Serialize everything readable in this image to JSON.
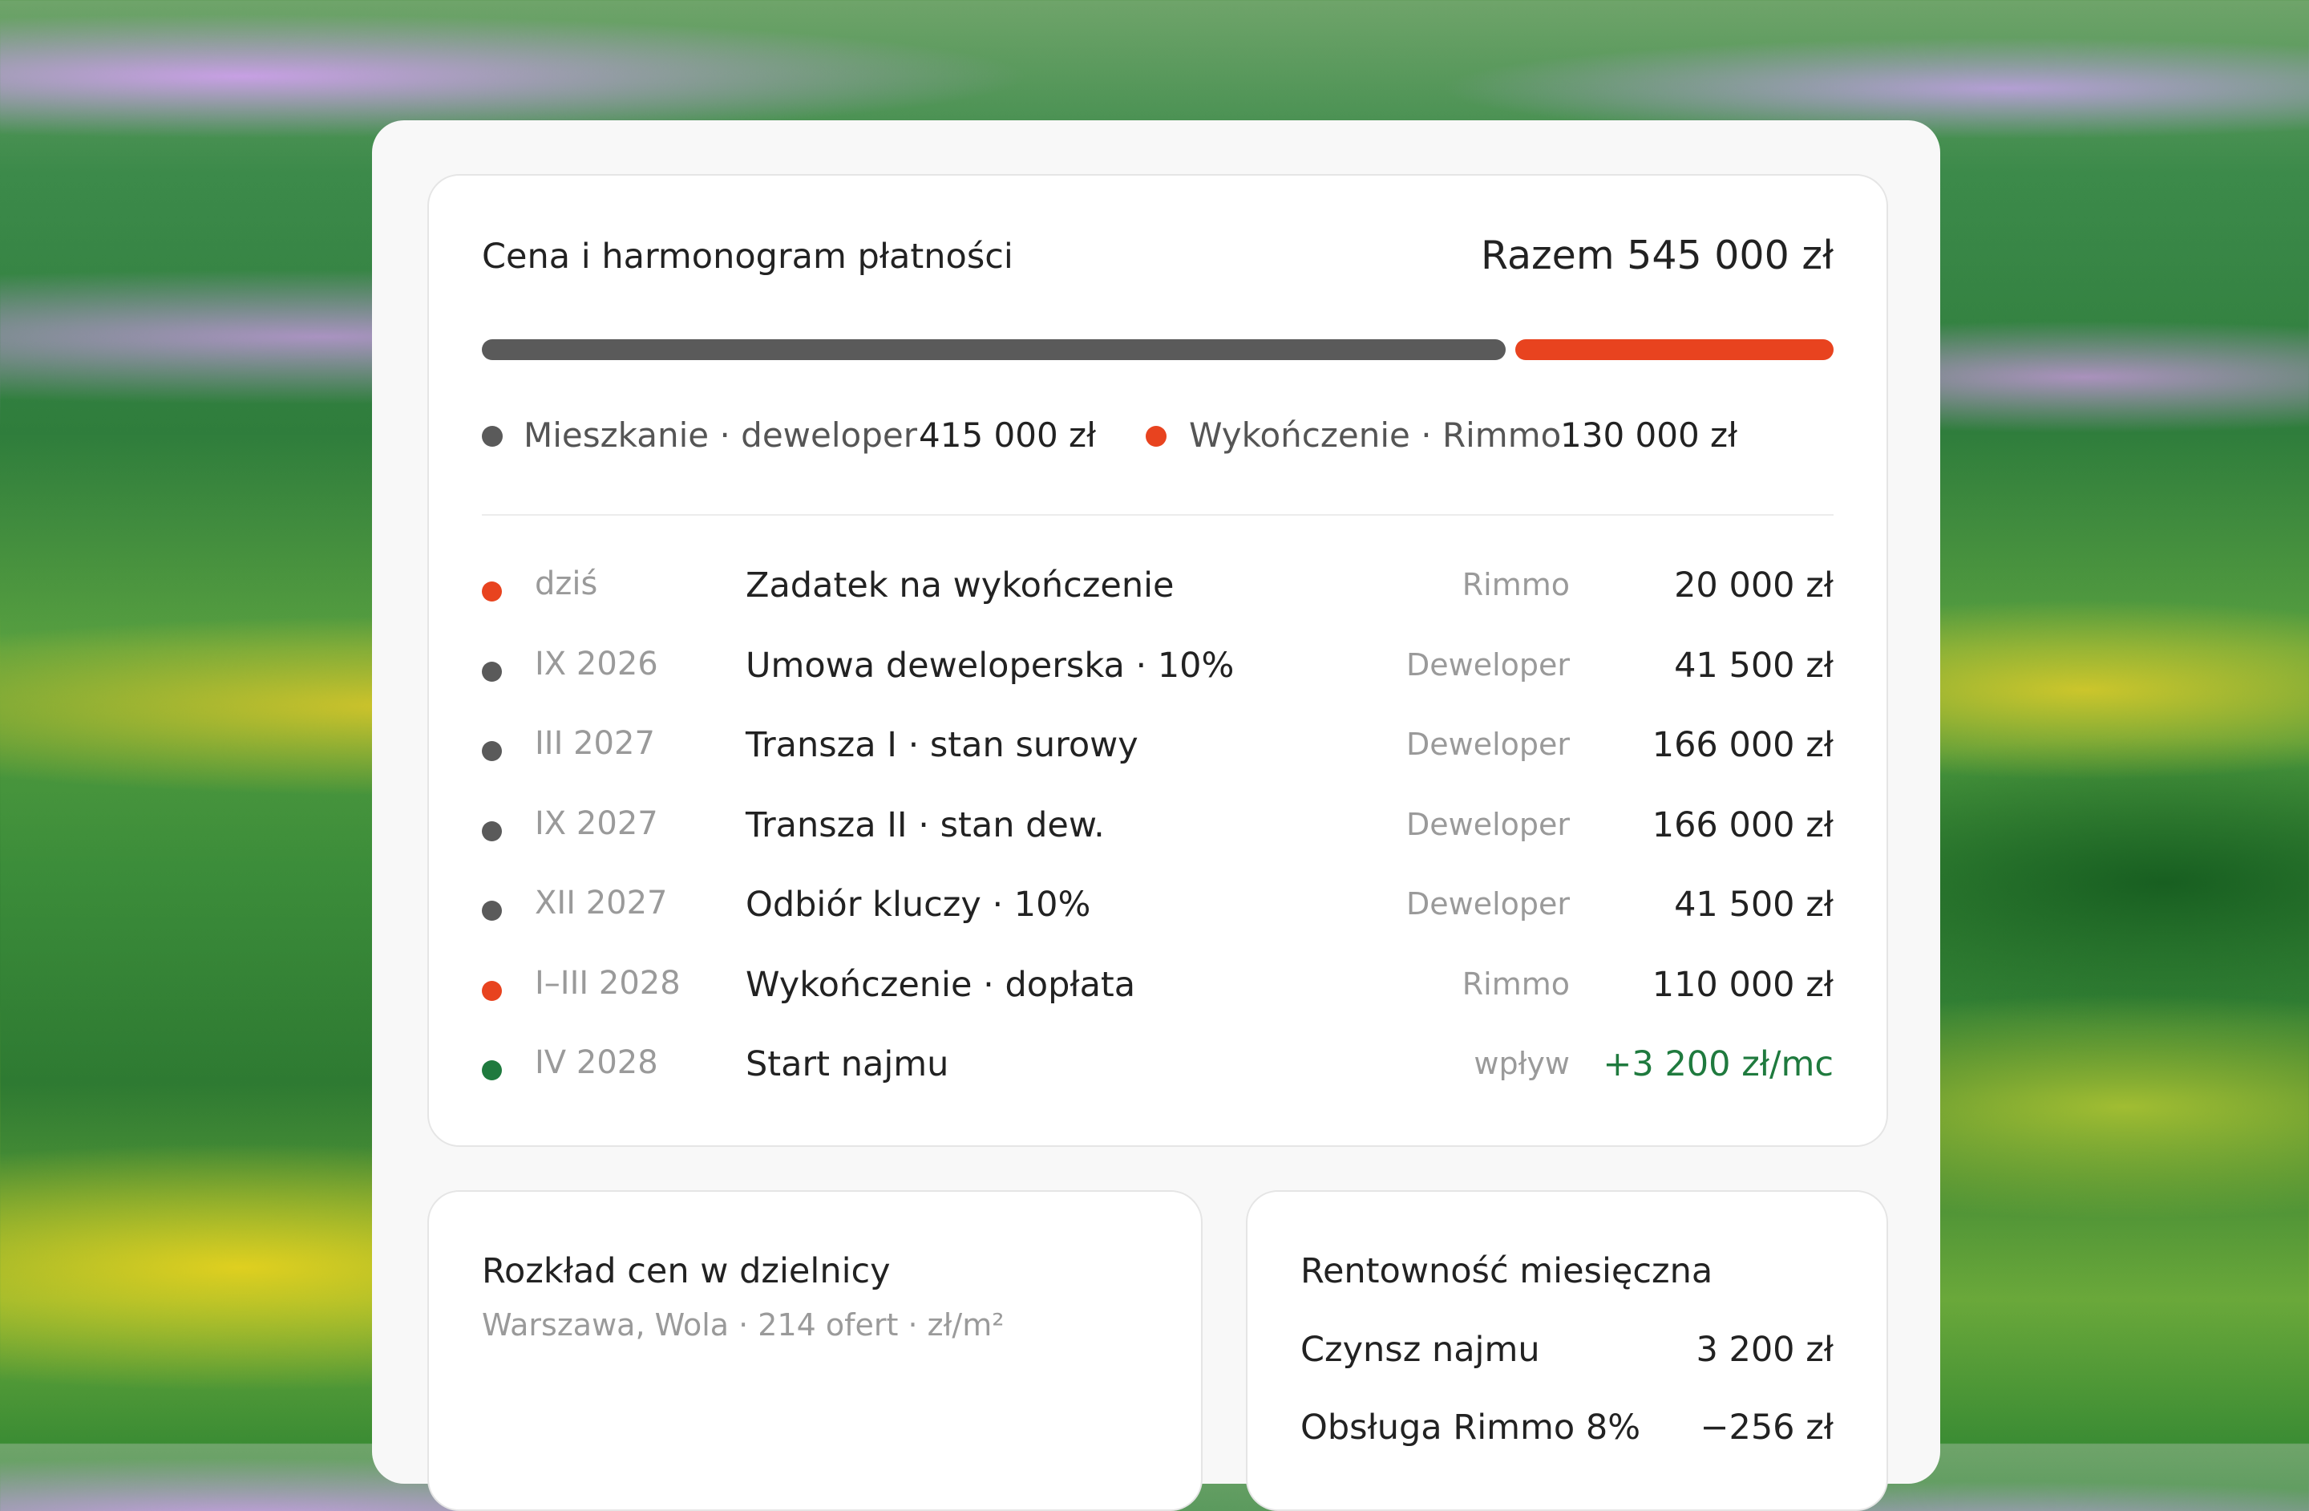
{
  "schedule": {
    "title": "Cena i harmonogram płatności",
    "total": "Razem 545 000 zł",
    "split": [
      {
        "label": "Mieszkanie · deweloper",
        "value": "415 000 zł",
        "share": 0.761,
        "color": "#5a5a5a"
      },
      {
        "label": "Wykończenie · Rimmo",
        "value": "130 000 zł",
        "share": 0.239,
        "color": "#e8431f"
      }
    ],
    "rows": [
      {
        "date": "dziś",
        "title": "Zadatek na wykończenie",
        "party": "Rimmo",
        "amount": "20 000 zł",
        "dot": "#e8431f",
        "amount_color": "#222222"
      },
      {
        "date": "IX 2026",
        "title": "Umowa deweloperska · 10%",
        "party": "Deweloper",
        "amount": "41 500 zł",
        "dot": "#5a5a5a",
        "amount_color": "#222222"
      },
      {
        "date": "III 2027",
        "title": "Transza I · stan surowy",
        "party": "Deweloper",
        "amount": "166 000 zł",
        "dot": "#5a5a5a",
        "amount_color": "#222222"
      },
      {
        "date": "IX 2027",
        "title": "Transza II · stan dew.",
        "party": "Deweloper",
        "amount": "166 000 zł",
        "dot": "#5a5a5a",
        "amount_color": "#222222"
      },
      {
        "date": "XII 2027",
        "title": "Odbiór kluczy · 10%",
        "party": "Deweloper",
        "amount": "41 500 zł",
        "dot": "#5a5a5a",
        "amount_color": "#222222"
      },
      {
        "date": "I–III 2028",
        "title": "Wykończenie · dopłata",
        "party": "Rimmo",
        "amount": "110 000 zł",
        "dot": "#e8431f",
        "amount_color": "#222222"
      },
      {
        "date": "IV 2028",
        "title": "Start najmu",
        "party": "wpływ",
        "amount": "+3 200 zł/mc",
        "dot": "#1f7a3e",
        "amount_color": "#1f7a3e"
      }
    ]
  },
  "distribution": {
    "title": "Rozkład cen w dzielnicy",
    "subtitle": "Warszawa, Wola · 214 ofert · zł/m²"
  },
  "profitability": {
    "title": "Rentowność miesięczna",
    "rows": [
      {
        "label": "Czynsz najmu",
        "value": "3 200 zł"
      },
      {
        "label": "Obsługa Rimmo 8%",
        "value": "−256 zł"
      }
    ]
  }
}
